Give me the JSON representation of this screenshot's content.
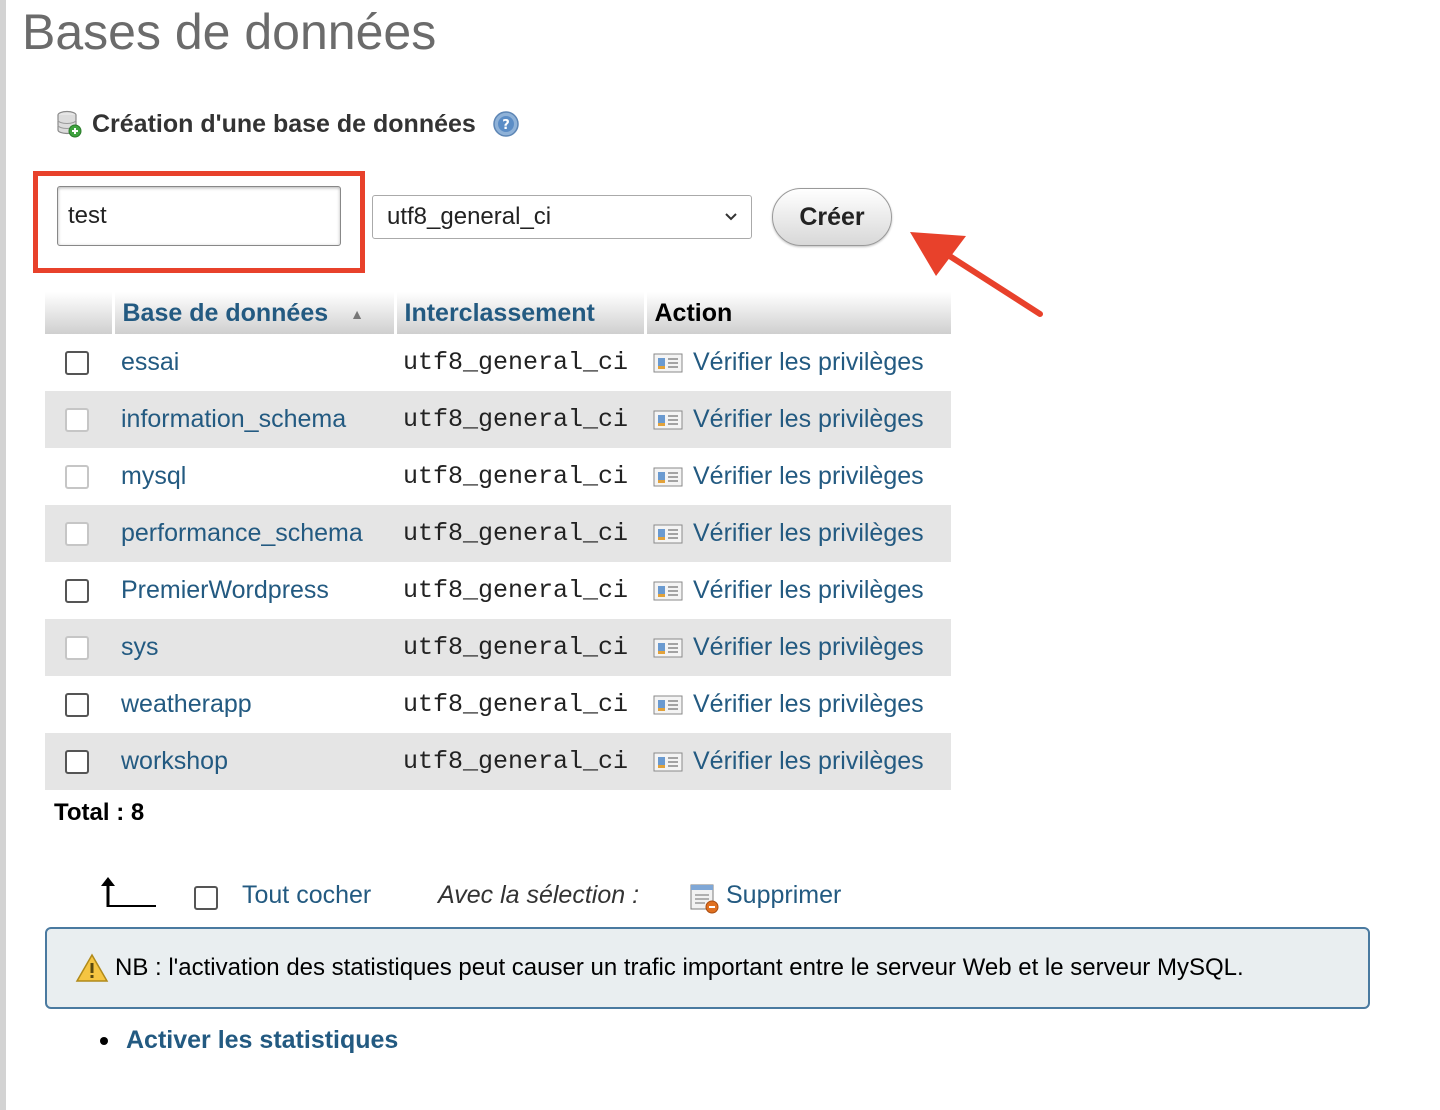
{
  "page": {
    "title": "Bases de données"
  },
  "create": {
    "heading": "Création d'une base de données",
    "db_name_value": "test",
    "collation_selected": "utf8_general_ci",
    "create_button": "Créer"
  },
  "table": {
    "headers": {
      "database": "Base de données",
      "collation": "Interclassement",
      "action": "Action"
    },
    "rows": [
      {
        "name": "essai",
        "collation": "utf8_general_ci",
        "action": "Vérifier les privilèges"
      },
      {
        "name": "information_schema",
        "collation": "utf8_general_ci",
        "action": "Vérifier les privilèges"
      },
      {
        "name": "mysql",
        "collation": "utf8_general_ci",
        "action": "Vérifier les privilèges"
      },
      {
        "name": "performance_schema",
        "collation": "utf8_general_ci",
        "action": "Vérifier les privilèges"
      },
      {
        "name": "PremierWordpress",
        "collation": "utf8_general_ci",
        "action": "Vérifier les privilèges"
      },
      {
        "name": "sys",
        "collation": "utf8_general_ci",
        "action": "Vérifier les privilèges"
      },
      {
        "name": "weatherapp",
        "collation": "utf8_general_ci",
        "action": "Vérifier les privilèges"
      },
      {
        "name": "workshop",
        "collation": "utf8_general_ci",
        "action": "Vérifier les privilèges"
      }
    ],
    "total_label": "Total : 8"
  },
  "bulk": {
    "check_all": "Tout cocher",
    "with_selection": "Avec la sélection :",
    "delete": "Supprimer"
  },
  "notice": {
    "text": "NB : l'activation des statistiques peut causer un trafic important entre le serveur Web et le serveur MySQL."
  },
  "stats": {
    "enable_link": "Activer les statistiques"
  },
  "colors": {
    "link": "#235a81",
    "annotation_red": "#e8412b",
    "row_alt": "#e5e5e5",
    "notice_border": "#4a7aa0",
    "notice_bg": "#e9eef0"
  },
  "icons": {
    "create_db": "database-add-icon",
    "help": "help-icon",
    "sort": "sort-ascending-icon",
    "privileges": "privileges-icon",
    "check_all_arrow": "arrow-ltr-icon",
    "delete": "delete-icon",
    "warning": "warning-icon"
  }
}
